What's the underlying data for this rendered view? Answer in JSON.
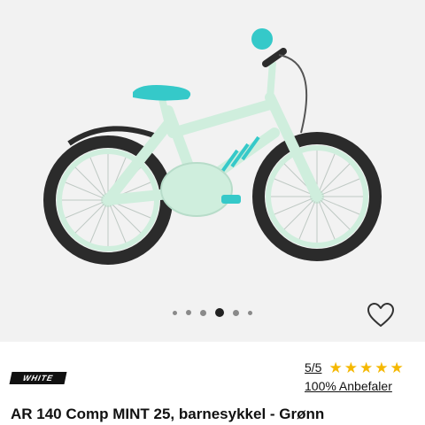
{
  "gallery": {
    "image_alt": "Kids bicycle in mint green",
    "dot_count": 6,
    "active_dot": 3,
    "favorite_icon": "heart-outline-icon"
  },
  "product": {
    "brand": "WHITE",
    "rating": "5/5",
    "stars": 5,
    "recommend": "100% Anbefaler",
    "title": "AR 140 Comp MINT 25, barnesykkel - Grønn"
  },
  "colors": {
    "frame": "#cfeedd",
    "accent": "#35c9c9",
    "tire": "#2b2b2b",
    "star": "#f5b800",
    "gallery_bg": "#f2f2f2"
  }
}
